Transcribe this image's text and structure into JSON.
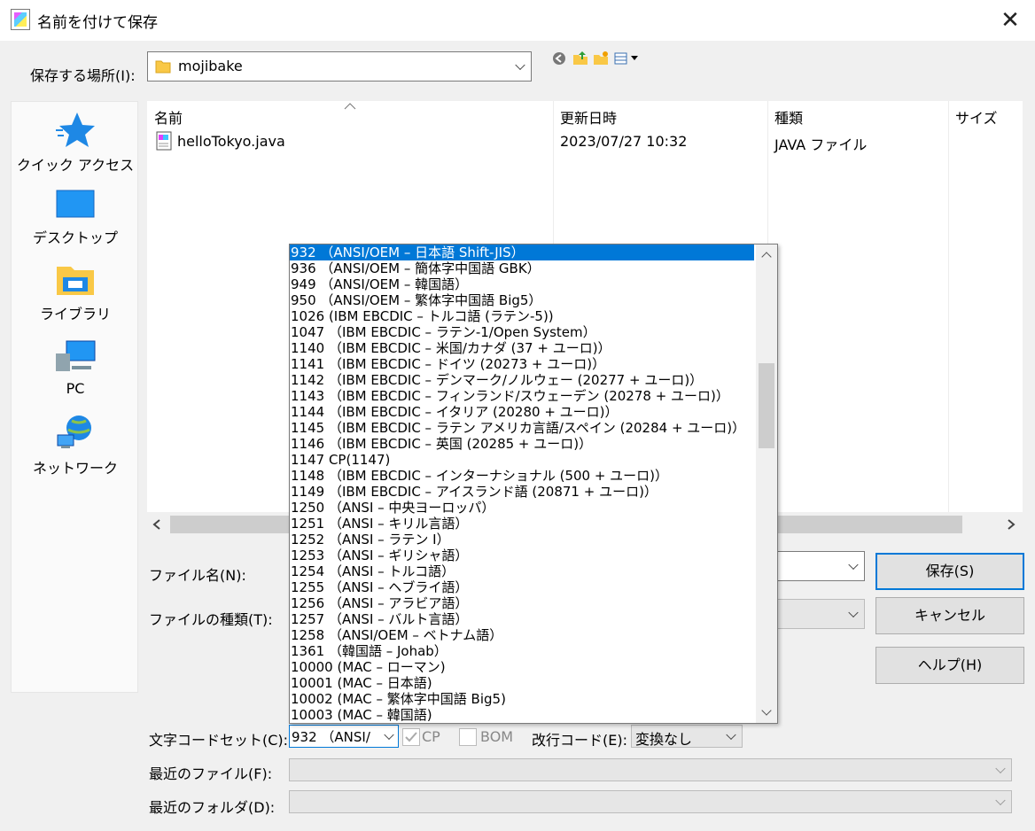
{
  "window": {
    "title": "名前を付けて保存",
    "close_glyph": "✕"
  },
  "location": {
    "label": "保存する場所(I):",
    "value": "mojibake"
  },
  "places": [
    {
      "label": "クイック アクセス",
      "icon": "star-icon"
    },
    {
      "label": "デスクトップ",
      "icon": "desktop-icon"
    },
    {
      "label": "ライブラリ",
      "icon": "library-icon"
    },
    {
      "label": "PC",
      "icon": "pc-icon"
    },
    {
      "label": "ネットワーク",
      "icon": "network-icon"
    }
  ],
  "file_list": {
    "columns": [
      "名前",
      "更新日時",
      "種類",
      "サイズ"
    ],
    "rows": [
      {
        "name": "helloTokyo.java",
        "modified": "2023/07/27 10:32",
        "type": "JAVA ファイル",
        "size": ""
      }
    ]
  },
  "filename": {
    "label": "ファイル名(N):"
  },
  "filetype": {
    "label": "ファイルの種類(T):"
  },
  "buttons": {
    "save": "保存(S)",
    "cancel": "キャンセル",
    "help": "ヘルプ(H)"
  },
  "charset": {
    "label": "文字コードセット(C):",
    "value": "932 （ANSI/",
    "cp_label": "CP",
    "bom_label": "BOM",
    "options": [
      "932 （ANSI/OEM – 日本語 Shift-JIS）",
      "936 （ANSI/OEM – 簡体字中国語 GBK）",
      "949 （ANSI/OEM – 韓国語）",
      "950 （ANSI/OEM – 繁体字中国語 Big5）",
      "1026 (IBM EBCDIC – トルコ語 (ラテン-5))",
      "1047 （IBM EBCDIC – ラテン-1/Open System）",
      "1140 （IBM EBCDIC – 米国/カナダ (37 + ユーロ)）",
      "1141 （IBM EBCDIC – ドイツ (20273 + ユーロ)）",
      "1142 （IBM EBCDIC – デンマーク/ノルウェー (20277 + ユーロ)）",
      "1143 （IBM EBCDIC – フィンランド/スウェーデン (20278 + ユーロ)）",
      "1144 （IBM EBCDIC – イタリア (20280 + ユーロ)）",
      "1145 （IBM EBCDIC – ラテン アメリカ言語/スペイン (20284 + ユーロ)）",
      "1146 （IBM EBCDIC – 英国 (20285 + ユーロ)）",
      "1147 CP(1147)",
      "1148 （IBM EBCDIC – インターナショナル (500 + ユーロ)）",
      "1149 （IBM EBCDIC – アイスランド語 (20871 + ユーロ)）",
      "1250 （ANSI – 中央ヨーロッパ）",
      "1251 （ANSI – キリル言語）",
      "1252 （ANSI – ラテン I）",
      "1253 （ANSI – ギリシャ語）",
      "1254 （ANSI – トルコ語）",
      "1255 （ANSI – ヘブライ語）",
      "1256 （ANSI – アラビア語）",
      "1257 （ANSI – バルト言語）",
      "1258 （ANSI/OEM – ベトナム語）",
      "1361 （韓国語 – Johab）",
      "10000 (MAC – ローマン)",
      "10001 (MAC – 日本語)",
      "10002 (MAC – 繁体字中国語 Big5)",
      "10003 (MAC – 韓国語)"
    ]
  },
  "newline": {
    "label": "改行コード(E):",
    "value": "変換なし"
  },
  "recent_files": {
    "label": "最近のファイル(F):"
  },
  "recent_folders": {
    "label": "最近のフォルダ(D):"
  },
  "colors": {
    "accent": "#0078d7",
    "folder": "#f9c846",
    "selection": "#0078d7"
  }
}
